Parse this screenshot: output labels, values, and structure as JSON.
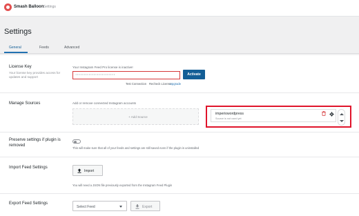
{
  "header": {
    "brand": "Smash Balloon",
    "breadcrumb": "/ Settings"
  },
  "page": {
    "title": "Settings"
  },
  "tabs": [
    {
      "label": "General",
      "active": true
    },
    {
      "label": "Feeds",
      "active": false
    },
    {
      "label": "Advanced",
      "active": false
    }
  ],
  "license": {
    "title": "License Key",
    "description": "Your license key provides access for updates and support",
    "status_text": "Your Instagram Feed Pro license is inactive!",
    "input_value": "••••••••••••••••••••••••",
    "activate_label": "Activate",
    "links": [
      "Test Connection",
      "Recheck License",
      "Upgrade"
    ]
  },
  "sources": {
    "title": "Manage Sources",
    "description": "Add or remove connected Instagram accounts",
    "add_label": "+ Add Source",
    "account": {
      "name": "imperiowordpress",
      "note": "Source is not used yet"
    }
  },
  "preserve": {
    "title": "Preserve settings if plugin is removed",
    "description": "This will make sure that all of your feeds and settings are still saved even if the plugin is uninstalled",
    "enabled": false
  },
  "import": {
    "title": "Import Feed Settings",
    "button_label": "Import",
    "description": "You will need a JSON file previously exported from the Instagram Feed Plugin"
  },
  "export": {
    "title": "Export Feed Settings",
    "select_label": "Select Feed",
    "button_label": "Export"
  },
  "colors": {
    "accent": "#2271b1",
    "activate": "#135e96",
    "error": "#d63638",
    "highlight": "#e0132a"
  }
}
